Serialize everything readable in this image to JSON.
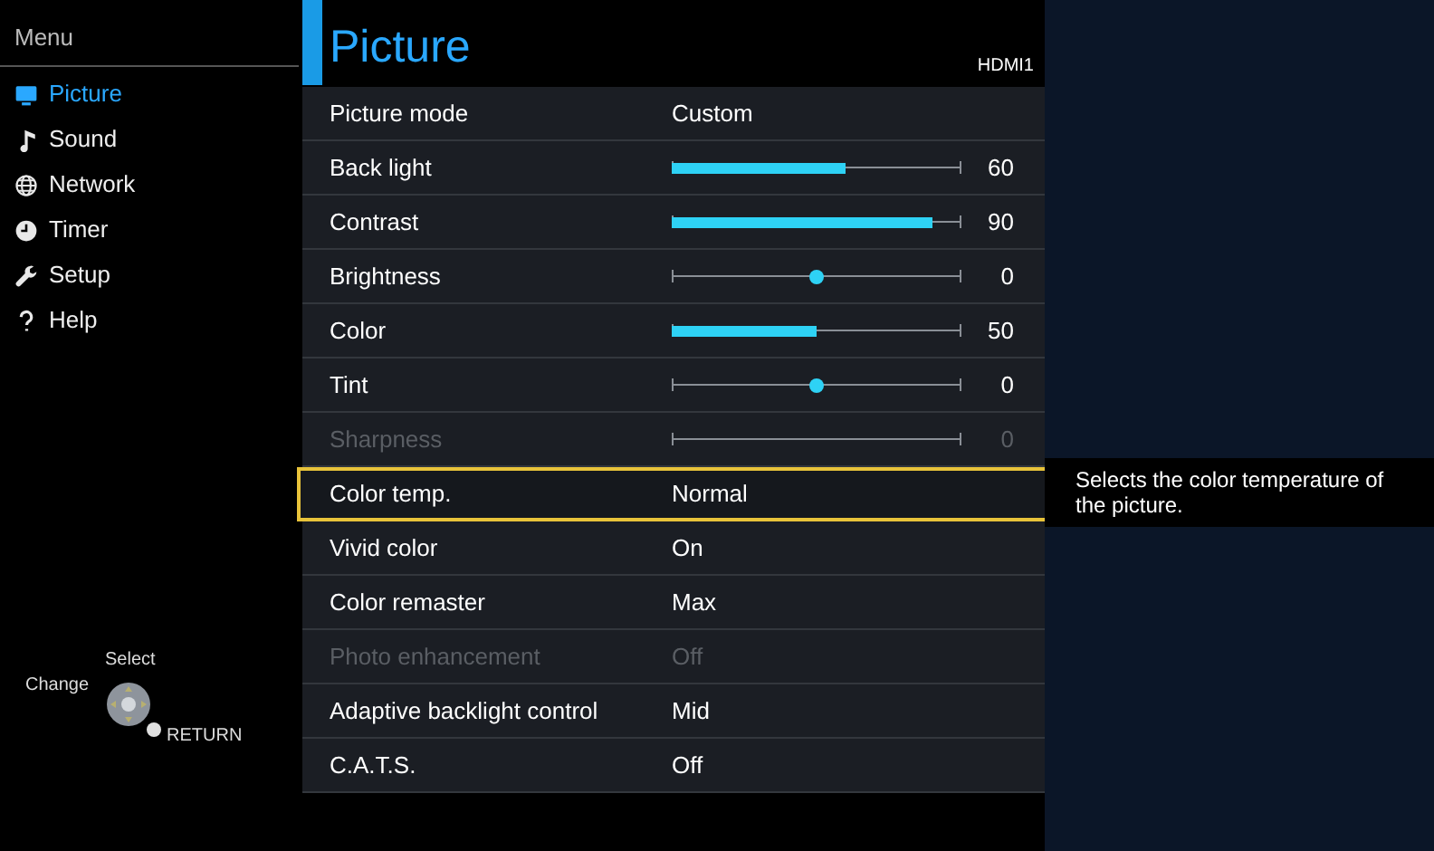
{
  "menu": {
    "title": "Menu",
    "items": [
      {
        "label": "Picture",
        "selected": true
      },
      {
        "label": "Sound",
        "selected": false
      },
      {
        "label": "Network",
        "selected": false
      },
      {
        "label": "Timer",
        "selected": false
      },
      {
        "label": "Setup",
        "selected": false
      },
      {
        "label": "Help",
        "selected": false
      }
    ]
  },
  "remote_hint": {
    "select": "Select",
    "change": "Change",
    "return": "RETURN"
  },
  "panel": {
    "title": "Picture",
    "input": "HDMI1",
    "rows": [
      {
        "kind": "value",
        "label": "Picture mode",
        "value": "Custom",
        "disabled": false,
        "selected": false
      },
      {
        "kind": "bar",
        "label": "Back light",
        "level": 0.6,
        "reading": "60",
        "disabled": false,
        "selected": false
      },
      {
        "kind": "bar",
        "label": "Contrast",
        "level": 0.9,
        "reading": "90",
        "disabled": false,
        "selected": false
      },
      {
        "kind": "dot",
        "label": "Brightness",
        "level": 0.5,
        "reading": "0",
        "disabled": false,
        "selected": false
      },
      {
        "kind": "bar",
        "label": "Color",
        "level": 0.5,
        "reading": "50",
        "disabled": false,
        "selected": false
      },
      {
        "kind": "dot",
        "label": "Tint",
        "level": 0.5,
        "reading": "0",
        "disabled": false,
        "selected": false
      },
      {
        "kind": "track",
        "label": "Sharpness",
        "reading": "0",
        "disabled": true,
        "selected": false
      },
      {
        "kind": "value",
        "label": "Color temp.",
        "value": "Normal",
        "disabled": false,
        "selected": true
      },
      {
        "kind": "value",
        "label": "Vivid color",
        "value": "On",
        "disabled": false,
        "selected": false
      },
      {
        "kind": "value",
        "label": "Color remaster",
        "value": "Max",
        "disabled": false,
        "selected": false
      },
      {
        "kind": "value",
        "label": "Photo enhancement",
        "value": "Off",
        "disabled": true,
        "selected": false
      },
      {
        "kind": "value",
        "label": "Adaptive backlight control",
        "value": "Mid",
        "disabled": false,
        "selected": false
      },
      {
        "kind": "value",
        "label": "C.A.T.S.",
        "value": "Off",
        "disabled": false,
        "selected": false
      }
    ]
  },
  "help_text": "Selects the color temperature of the picture."
}
